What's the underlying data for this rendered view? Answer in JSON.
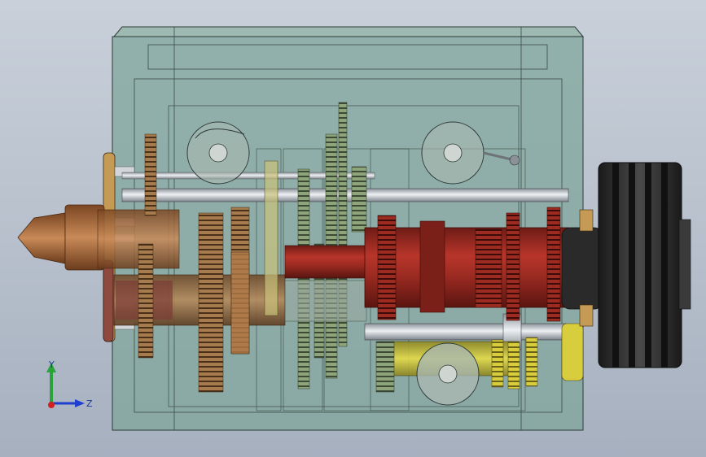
{
  "view": {
    "background_top": "#c9d0da",
    "background_bottom": "#a6b0bf",
    "housing_color": "#7ea59a",
    "spindle_color": "#9c2b22",
    "pulley_color": "#2b2b2b",
    "shaft_color": "#c7ccd2",
    "gear_bronze": "#a67b4e",
    "gear_yellow": "#d9cf3a"
  },
  "triad": {
    "y_label": "Y",
    "z_label": "Z",
    "y_color": "#2aa33a",
    "z_color": "#1f3fd0",
    "x_color": "#d02020"
  }
}
